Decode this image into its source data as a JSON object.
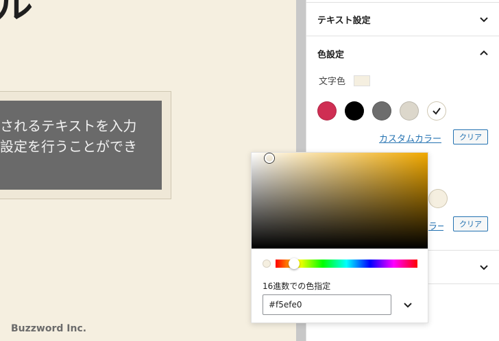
{
  "canvas": {
    "heading_fragment": "ル",
    "frame_text_line1": "されるテキストを入力",
    "frame_text_line2": "設定を行うことができ",
    "brand": "Buzzword Inc."
  },
  "sidebar": {
    "text_settings": {
      "label": "テキスト設定",
      "icon": "chevron-down-icon"
    },
    "color_settings": {
      "label": "色設定",
      "icon": "chevron-up-icon",
      "text_color_label": "文字色",
      "text_color_value": "#f5efe0",
      "palette": [
        {
          "name": "crimson",
          "color": "#cf2e53"
        },
        {
          "name": "black",
          "color": "#000000"
        },
        {
          "name": "gray",
          "color": "#6d6d6d"
        },
        {
          "name": "beige",
          "color": "#dcd7cb"
        },
        {
          "name": "white-selected",
          "color": "#ffffff",
          "selected": true
        }
      ],
      "custom_color_label": "カスタムカラー",
      "custom_color_label_partial": "ラー",
      "clear_label": "クリア"
    },
    "third_section": {
      "icon": "chevron-down-icon"
    }
  },
  "picker": {
    "hex_label": "16進数での色指定",
    "hex_value": "#f5efe0",
    "base_hue_color": "#f0a800",
    "preview_color": "#f5efe0"
  }
}
